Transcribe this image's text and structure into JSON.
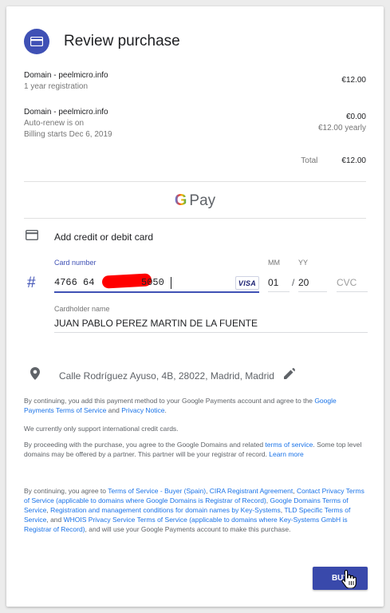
{
  "header": {
    "title": "Review purchase",
    "icon": "credit-card-icon"
  },
  "items": [
    {
      "name": "Domain - peelmicro.info",
      "sub1": "1 year registration",
      "price": "€12.00"
    },
    {
      "name": "Domain - peelmicro.info",
      "sub1": "Auto-renew is on",
      "sub2": "Billing starts Dec 6, 2019",
      "price": "€0.00",
      "price_sub": "€12.00 yearly"
    }
  ],
  "total": {
    "label": "Total",
    "value": "€12.00"
  },
  "gpay": {
    "g": "G",
    "pay": "Pay"
  },
  "payment": {
    "add_card_label": "Add credit or debit card",
    "card_number_label": "Card number",
    "card_number_start": "4766 64",
    "card_number_end": "5050",
    "card_brand": "VISA",
    "mm_label": "MM",
    "mm_value": "01",
    "yy_label": "YY",
    "yy_value": "20",
    "slash": "/",
    "cvc_placeholder": "CVC",
    "cardholder_label": "Cardholder name",
    "cardholder_value": "JUAN PABLO PEREZ MARTIN DE LA FUENTE"
  },
  "address": {
    "text": "Calle Rodríguez Ayuso, 4B, 28022, Madrid, Madrid"
  },
  "legal": {
    "p1_text": "By continuing, you add this payment method to your Google Payments account and agree to the ",
    "p1_link1": "Google Payments Terms of Service",
    "p1_and": " and ",
    "p1_link2": "Privacy Notice",
    "p1_end": ".",
    "p2": "We currently only support international credit cards.",
    "p3_text": "By proceeding with the purchase, you agree to the Google Domains and related ",
    "p3_link1": "terms of service",
    "p3_mid": ". Some top level domains may be offered by a partner. This partner will be your registrar of record. ",
    "p3_link2": "Learn more",
    "p4_text": "By continuing, you agree to ",
    "p4_link1": "Terms of Service - Buyer (Spain)",
    "p4_comma1": ", ",
    "p4_link2": "CIRA Registrant Agreement",
    "p4_comma2": ", ",
    "p4_link3": "Contact Privacy Terms of Service (applicable to domains where Google Domains is Registrar of Record)",
    "p4_comma3": ", ",
    "p4_link4": "Google Domains Terms of Service",
    "p4_comma4": ", ",
    "p4_link5": "Registration and management conditions for domain names by Key-Systems",
    "p4_comma5": ", ",
    "p4_link6": "TLD Specific Terms of Service",
    "p4_and": ", and ",
    "p4_link7": "WHOIS Privacy Service Terms of Service (applicable to domains where Key-Systems GmbH is Registrar of Record)",
    "p4_end": ", and will use your Google Payments account to make this purchase."
  },
  "buy_button": {
    "label": "BUY"
  },
  "colors": {
    "accent": "#3f51b5",
    "link": "#1a73e8",
    "redaction": "#ff0000"
  }
}
